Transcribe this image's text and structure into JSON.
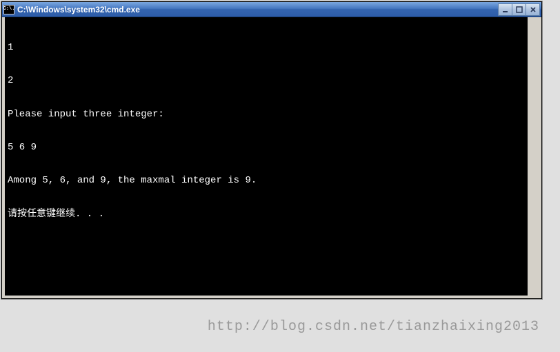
{
  "window": {
    "title": "C:\\Windows\\system32\\cmd.exe",
    "icon_text": "C:\\."
  },
  "terminal": {
    "lines": [
      "1",
      "2",
      "Please input three integer:",
      "5 6 9",
      "Among 5, 6, and 9, the maxmal integer is 9.",
      "请按任意键继续. . ."
    ]
  },
  "watermark": "http://blog.csdn.net/tianzhaixing2013"
}
